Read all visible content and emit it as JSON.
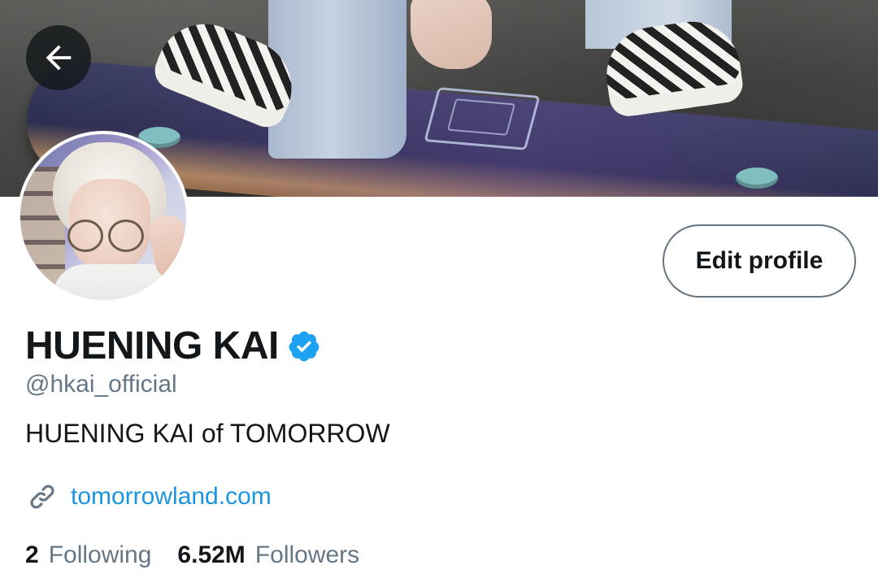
{
  "header": {
    "back_icon": "arrow-left-icon"
  },
  "profile": {
    "display_name": "HUENING KAI",
    "verified_icon": "verified-badge-icon",
    "handle": "@hkai_official",
    "bio": "HUENING KAI of TOMORROW",
    "website": "tomorrowland.com",
    "website_icon": "link-icon"
  },
  "actions": {
    "edit_profile_label": "Edit profile"
  },
  "stats": {
    "following_count": "2",
    "following_label": "Following",
    "followers_count": "6.52M",
    "followers_label": "Followers"
  },
  "colors": {
    "primary_text": "#14171a",
    "secondary_text": "#657786",
    "link": "#1b95e0",
    "verified": "#1da1f2"
  }
}
